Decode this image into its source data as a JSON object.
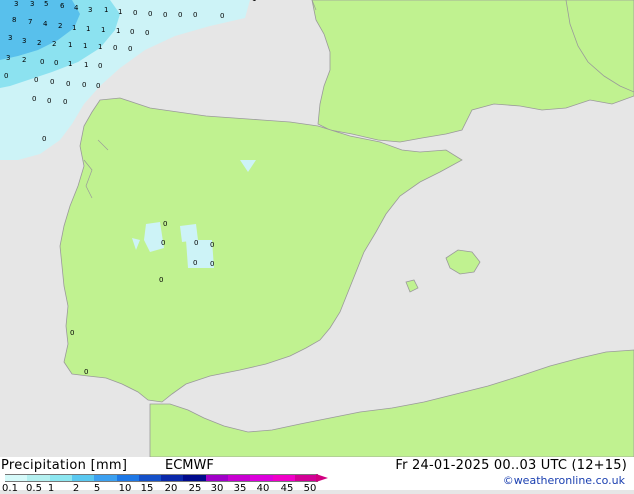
{
  "footer": {
    "title": "Precipitation [mm]",
    "model": "ECMWF",
    "date": "Fr 24-01-2025 00..03 UTC (12+15)",
    "credit": "©weatheronline.co.uk"
  },
  "legend": {
    "ticks": [
      "0.1",
      "0.5",
      "1",
      "2",
      "5",
      "10",
      "15",
      "20",
      "25",
      "30",
      "35",
      "40",
      "45",
      "50"
    ],
    "colors": [
      "#d6fafa",
      "#b4f0f0",
      "#8ce6f0",
      "#5ac8f0",
      "#3ca0f0",
      "#1e78e6",
      "#1450c8",
      "#0a28aa",
      "#000a8c",
      "#a000c8",
      "#c800d2",
      "#dc00dc",
      "#f000c8",
      "#d20096"
    ]
  },
  "map": {
    "colors": {
      "sea": "#e6e6e6",
      "land": "#c0f290",
      "coast": "#9a9a9a",
      "light_precip": "#cdf3f7",
      "medium_precip": "#8ce2f0",
      "heavy_precip": "#58c0ec"
    },
    "labels": [
      "3",
      "3",
      "5",
      "6",
      "4",
      "3",
      "1",
      "1",
      "0",
      "0",
      "0",
      "0",
      "0",
      "8",
      "7",
      "4",
      "2",
      "1",
      "1",
      "1",
      "1",
      "0",
      "0",
      "3",
      "3",
      "2",
      "2",
      "1",
      "1",
      "1",
      "0",
      "0",
      "3",
      "2",
      "0",
      "0",
      "1",
      "1",
      "0",
      "0",
      "0",
      "0",
      "0",
      "0",
      "0",
      "0",
      "0",
      "0",
      "0",
      "1",
      "0",
      "0",
      "0",
      "0",
      "0",
      "0",
      "0",
      "0",
      "0",
      "0"
    ]
  }
}
